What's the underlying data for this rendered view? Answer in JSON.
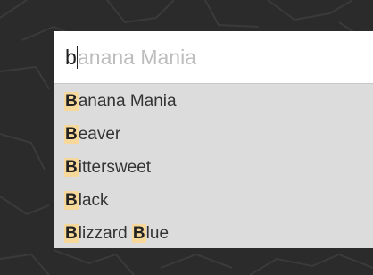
{
  "search": {
    "typed": "b",
    "suggestion_rest": "anana Mania"
  },
  "suggestions": [
    {
      "parts": [
        {
          "t": "B",
          "hl": true
        },
        {
          "t": "anana Mania",
          "hl": false
        }
      ]
    },
    {
      "parts": [
        {
          "t": "B",
          "hl": true
        },
        {
          "t": "eaver",
          "hl": false
        }
      ]
    },
    {
      "parts": [
        {
          "t": "B",
          "hl": true
        },
        {
          "t": "ittersweet",
          "hl": false
        }
      ]
    },
    {
      "parts": [
        {
          "t": "B",
          "hl": true
        },
        {
          "t": "lack",
          "hl": false
        }
      ]
    },
    {
      "parts": [
        {
          "t": "B",
          "hl": true
        },
        {
          "t": "lizzard ",
          "hl": false
        },
        {
          "t": "B",
          "hl": true
        },
        {
          "t": "lue",
          "hl": false
        }
      ]
    }
  ],
  "colors": {
    "background": "#2b2b2b",
    "highlight": "#f6d99a",
    "dropdown": "#dcdcdc"
  }
}
